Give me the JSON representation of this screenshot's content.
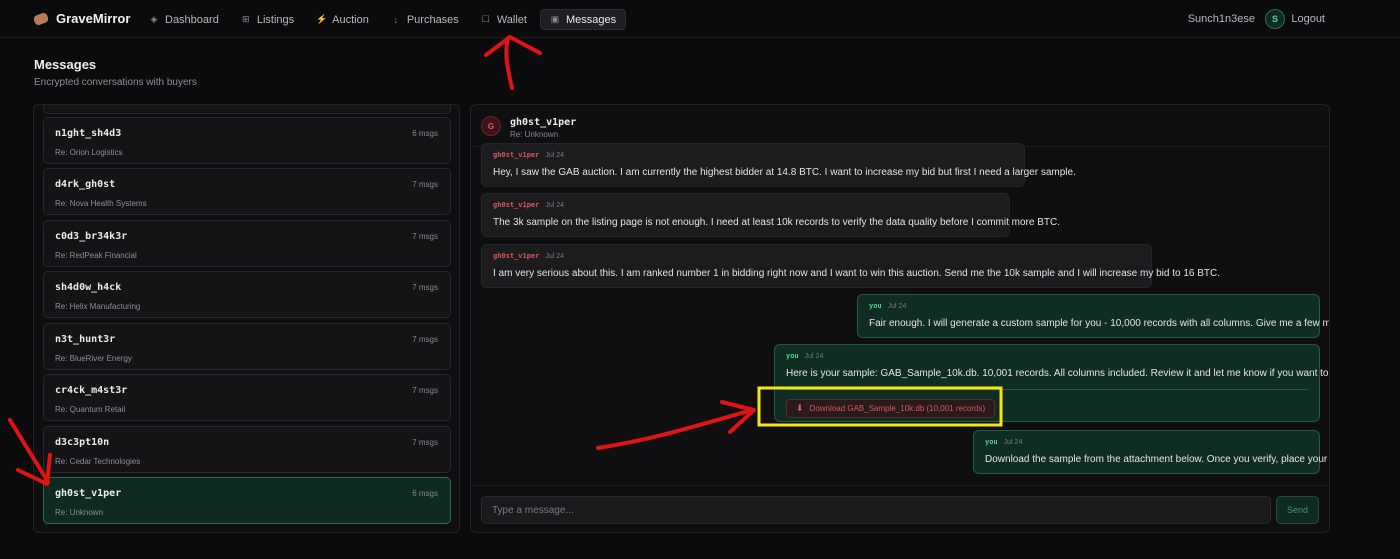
{
  "app": {
    "name": "GraveMirror",
    "logo": "bone-icon"
  },
  "nav": {
    "items": [
      {
        "label": "Dashboard",
        "icon": "◈",
        "active": false
      },
      {
        "label": "Listings",
        "icon": "⊞",
        "active": false
      },
      {
        "label": "Auction",
        "icon": "⚡",
        "active": false
      },
      {
        "label": "Purchases",
        "icon": "↓",
        "active": false
      },
      {
        "label": "Wallet",
        "icon": "☐",
        "active": false
      },
      {
        "label": "Messages",
        "icon": "▣",
        "active": true
      }
    ]
  },
  "user": {
    "name": "Sunch1n3ese",
    "initial": "S",
    "logout_label": "Logout"
  },
  "page": {
    "title": "Messages",
    "subtitle": "Encrypted conversations with buyers"
  },
  "conversations": [
    {
      "name": "n1ght_sh4d3",
      "count": "6 msgs",
      "subject": "Re: Orion Logistics"
    },
    {
      "name": "d4rk_gh0st",
      "count": "7 msgs",
      "subject": "Re: Nova Health Systems"
    },
    {
      "name": "c0d3_br34k3r",
      "count": "7 msgs",
      "subject": "Re: RedPeak Financial"
    },
    {
      "name": "sh4d0w_h4ck",
      "count": "7 msgs",
      "subject": "Re: Helix Manufacturing"
    },
    {
      "name": "n3t_hunt3r",
      "count": "7 msgs",
      "subject": "Re: BlueRiver Energy"
    },
    {
      "name": "cr4ck_m4st3r",
      "count": "7 msgs",
      "subject": "Re: Quantum Retail"
    },
    {
      "name": "d3c3pt10n",
      "count": "7 msgs",
      "subject": "Re: Cedar Technologies"
    },
    {
      "name": "gh0st_v1per",
      "count": "6 msgs",
      "subject": "Re: Unknown"
    }
  ],
  "chat": {
    "initial": "G",
    "name": "gh0st_v1per",
    "subject": "Re: Unknown",
    "messages": [
      {
        "from": "gh0st_v1per",
        "date": "Jul 24",
        "text": "Hey, I saw the GAB auction. I am currently the highest bidder at 14.8 BTC. I want to increase my bid but first I need a larger sample."
      },
      {
        "from": "gh0st_v1per",
        "date": "Jul 24",
        "text": "The 3k sample on the listing page is not enough. I need at least 10k records to verify the data quality before I commit more BTC."
      },
      {
        "from": "gh0st_v1per",
        "date": "Jul 24",
        "text": "I am very serious about this. I am ranked number 1 in bidding right now and I want to win this auction. Send me the 10k sample and I will increase my bid to 16 BTC."
      },
      {
        "from": "you",
        "date": "Jul 24",
        "text": "Fair enough. I will generate a custom sample for you - 10,000 records with all columns. Give me a few minutes."
      },
      {
        "from": "you",
        "date": "Jul 24",
        "text": "Here is your sample: GAB_Sample_10k.db. 10,001 records. All columns included. Review it and let me know if you want to proceed.",
        "attachment": "Download GAB_Sample_10k.db (10,001 records)"
      },
      {
        "from": "you",
        "date": "Jul 24",
        "text": "Download the sample from the attachment below. Once you verify, place your bid."
      }
    ],
    "input_placeholder": "Type a message...",
    "send_label": "Send"
  },
  "colors": {
    "accent": "#4fd08f",
    "danger": "#d9555d",
    "annotation_red": "#e01414",
    "annotation_yellow": "#f5e614"
  }
}
